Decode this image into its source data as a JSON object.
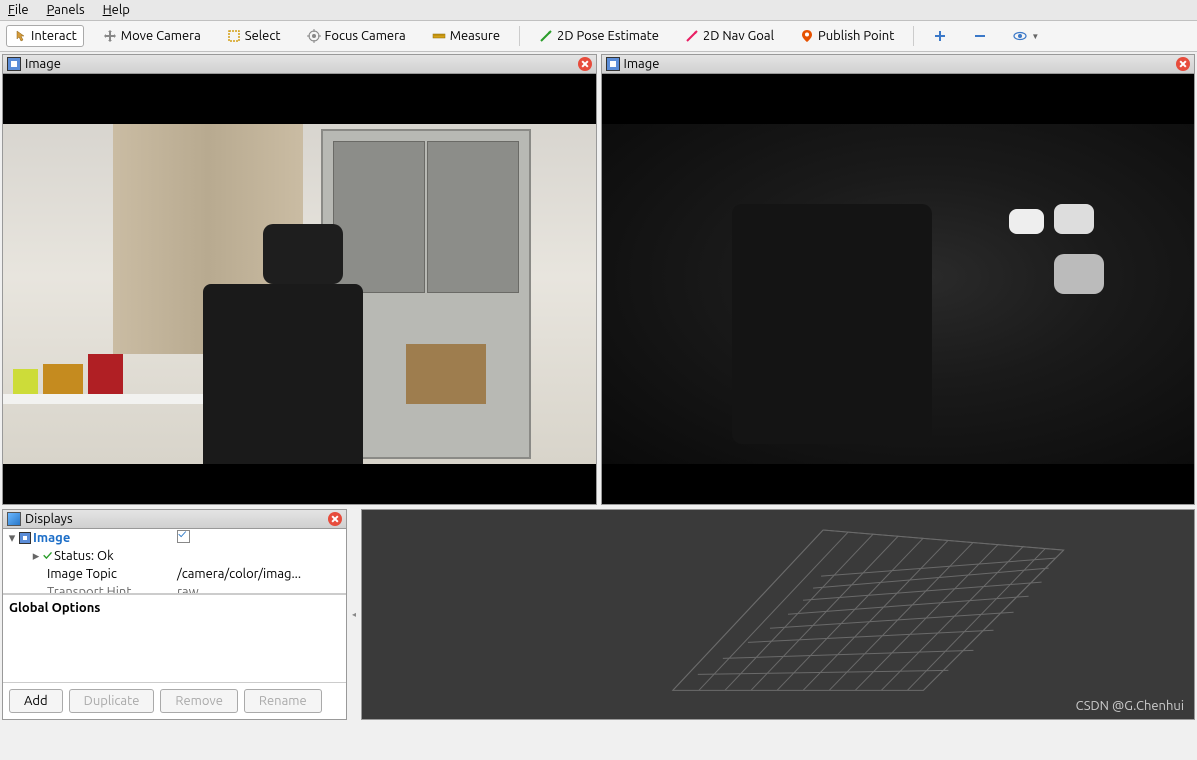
{
  "menubar": {
    "file": "File",
    "panels": "Panels",
    "help": "Help"
  },
  "toolbar": {
    "interact": "Interact",
    "move_camera": "Move Camera",
    "select": "Select",
    "focus_camera": "Focus Camera",
    "measure": "Measure",
    "pose_estimate": "2D Pose Estimate",
    "nav_goal": "2D Nav Goal",
    "publish_point": "Publish Point"
  },
  "panels": {
    "left_image_title": "Image",
    "right_image_title": "Image",
    "displays_title": "Displays"
  },
  "displays": {
    "tree": {
      "image_label": "Image",
      "image_checked": true,
      "status_label": "Status: Ok",
      "topic_label": "Image Topic",
      "topic_value": "/camera/color/imag...",
      "transport_label": "Transport Hint",
      "transport_value": "raw"
    },
    "description_title": "Global Options",
    "buttons": {
      "add": "Add",
      "duplicate": "Duplicate",
      "remove": "Remove",
      "rename": "Rename"
    }
  },
  "watermark": "CSDN @G.Chenhui"
}
